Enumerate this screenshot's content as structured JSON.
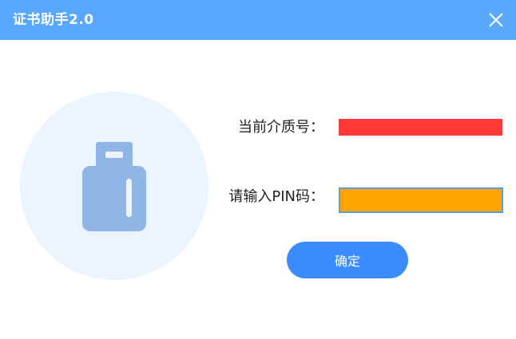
{
  "window": {
    "title": "证书助手2.0",
    "close_icon": "close-icon"
  },
  "device": {
    "icon": "usb-key-icon"
  },
  "form": {
    "media_label": "当前介质号：",
    "media_value": "",
    "pin_label": "请输入PIN码：",
    "pin_value": "",
    "pin_placeholder": ""
  },
  "actions": {
    "confirm_label": "确定"
  },
  "colors": {
    "titlebar": "#58a8ff",
    "accent_button": "#3d8cff",
    "media_value_redaction": "#ff3838",
    "pin_field_fill": "#ffa500",
    "device_circle": "#ebf4ff",
    "usb_icon": "#8fb4e6"
  }
}
